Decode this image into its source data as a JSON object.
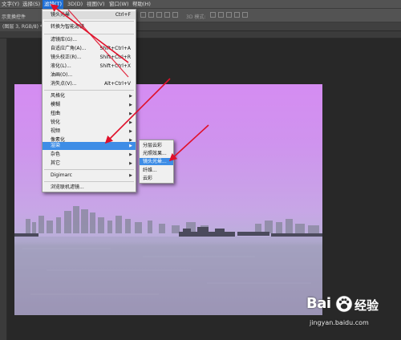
{
  "menubar": {
    "items": [
      "文字(Y)",
      "选择(S)",
      "滤镜(T)",
      "3D(D)",
      "视图(V)",
      "窗口(W)",
      "帮助(H)"
    ]
  },
  "optionsbar": {
    "label": "示变换控件",
    "mode_3d": "3D 模式:"
  },
  "document": {
    "tab": "(图层 3, RGB/8) *"
  },
  "filter_menu": {
    "items": [
      {
        "label": "镜头光晕",
        "shortcut": "Ctrl+F"
      },
      {
        "label": "转换为智能滤镜",
        "shortcut": ""
      },
      {
        "label": "滤镜库(G)...",
        "shortcut": ""
      },
      {
        "label": "自适应广角(A)...",
        "shortcut": "Shift+Ctrl+A"
      },
      {
        "label": "镜头校正(R)...",
        "shortcut": "Shift+Ctrl+R"
      },
      {
        "label": "液化(L)...",
        "shortcut": "Shift+Ctrl+X"
      },
      {
        "label": "油画(O)...",
        "shortcut": ""
      },
      {
        "label": "消失点(V)...",
        "shortcut": "Alt+Ctrl+V"
      },
      {
        "label": "风格化",
        "shortcut": ""
      },
      {
        "label": "模糊",
        "shortcut": ""
      },
      {
        "label": "扭曲",
        "shortcut": ""
      },
      {
        "label": "锐化",
        "shortcut": ""
      },
      {
        "label": "视频",
        "shortcut": ""
      },
      {
        "label": "像素化",
        "shortcut": ""
      },
      {
        "label": "渲染",
        "shortcut": ""
      },
      {
        "label": "杂色",
        "shortcut": ""
      },
      {
        "label": "其它",
        "shortcut": ""
      },
      {
        "label": "Digimarc",
        "shortcut": ""
      },
      {
        "label": "浏览联机滤镜...",
        "shortcut": ""
      }
    ],
    "selected": "渲染"
  },
  "render_submenu": {
    "items": [
      "分层云彩",
      "光照效果...",
      "镜头光晕...",
      "纤维...",
      "云彩"
    ],
    "selected": "镜头光晕..."
  },
  "watermark": {
    "logo_a": "Bai",
    "logo_b": "经验",
    "url": "jingyan.baidu.com"
  },
  "colors": {
    "highlight": "#3e8de6",
    "annotation_arrow": "#e0102a",
    "menubar_active": "#1e6fd6"
  }
}
